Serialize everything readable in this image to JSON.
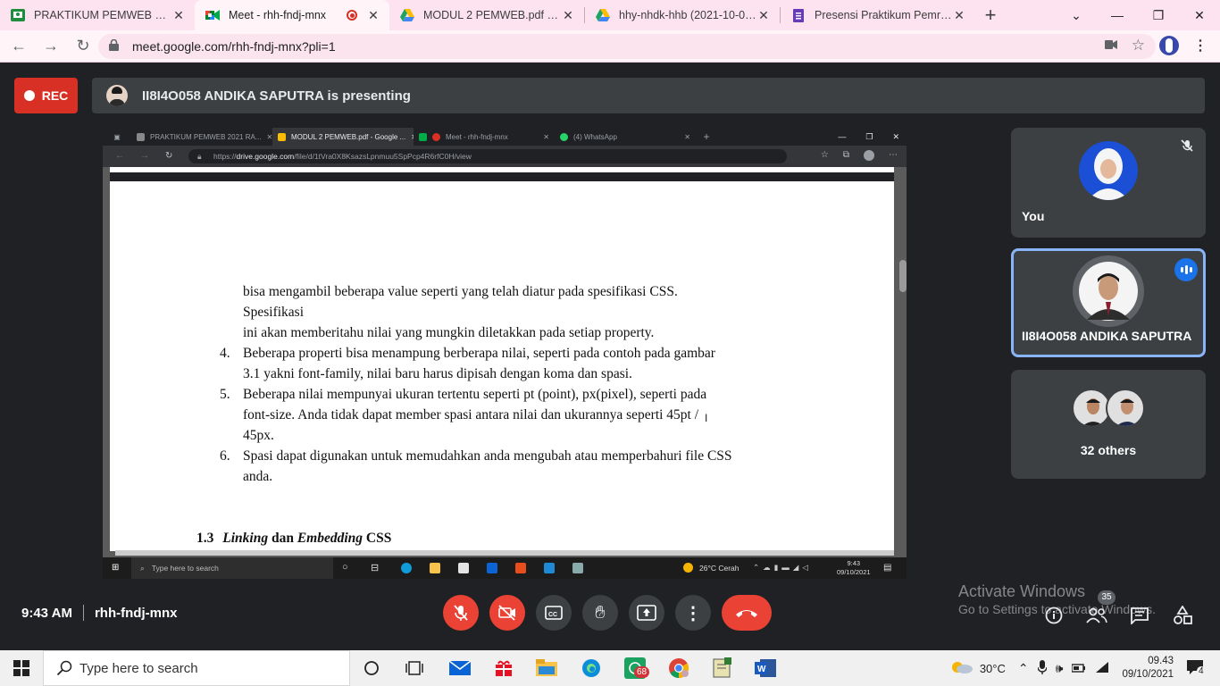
{
  "browser": {
    "tabs": [
      {
        "label": "PRAKTIKUM PEMWEB 2021 F",
        "icon": "classroom-icon"
      },
      {
        "label": "Meet - rhh-fndj-mnx",
        "icon": "meet-icon"
      },
      {
        "label": "MODUL 2 PEMWEB.pdf - Goo",
        "icon": "drive-icon"
      },
      {
        "label": "hhy-nhdk-hhb (2021-10-07 a",
        "icon": "drive-icon"
      },
      {
        "label": "Presensi Praktikum Pemrogra",
        "icon": "forms-icon"
      }
    ],
    "url": "meet.google.com/rhh-fndj-mnx?pli=1"
  },
  "meet": {
    "rec_label": "REC",
    "presenting_text": "II8I4O058 ANDIKA SAPUTRA is presenting",
    "time": "9:43 AM",
    "meeting_code": "rhh-fndj-mnx",
    "participants_badge": "35",
    "tiles": [
      {
        "name": "You"
      },
      {
        "name": "II8I4O058 ANDIKA SAPUTRA"
      },
      {
        "name": "32 others"
      }
    ],
    "watermark_title": "Activate Windows",
    "watermark_sub": "Go to Settings to activate Windows."
  },
  "shared_screen": {
    "tabs": [
      "PRAKTIKUM PEMWEB 2021 RA...",
      "MODUL 2 PEMWEB.pdf - Google ...",
      "Meet - rhh-fndj-mnx",
      "(4) WhatsApp"
    ],
    "url_prefix": "https://",
    "url_host": "drive.google.com",
    "url_path": "/file/d/1tVra0X8KsazsLpnmuu5SpPcp4R6rfC0H/view",
    "doc_lines": {
      "l1": "bisa mengambil beberapa value seperti yang telah diatur pada spesifikasi CSS.",
      "l2": "Spesifikasi",
      "l3": "ini akan memberitahu nilai yang mungkin diletakkan pada setiap property.",
      "n4": "4.",
      "l4a": "Beberapa properti bisa menampung berberapa nilai, seperti pada contoh pada gambar",
      "l4b": "3.1 yakni font-family, nilai baru harus dipisah dengan koma dan spasi.",
      "n5": "5.",
      "l5a": "Beberapa nilai mempunyai ukuran tertentu seperti pt (point), px(pixel), seperti pada",
      "l5b": "font-size. Anda tidak dapat member spasi antara nilai dan ukurannya seperti 45pt /",
      "l5c": "45px.",
      "n6": "6.",
      "l6a": "Spasi dapat digunakan untuk memudahkan anda mengubah atau memperbahuri file CSS",
      "l6b": "anda.",
      "heading_num": "1.3",
      "heading_em1": "Linking",
      "heading_mid": "dan",
      "heading_em2": "Embedding",
      "heading_end": "CSS"
    },
    "taskbar_search": "Type here to search",
    "weather": "26°C  Cerah",
    "clock_time": "9:43",
    "clock_date": "09/10/2021"
  },
  "taskbar": {
    "search_placeholder": "Type here to search",
    "weather": "30°C",
    "time": "09.43",
    "date": "09/10/2021",
    "whatsapp_badge": "68",
    "notif_count": "4"
  }
}
